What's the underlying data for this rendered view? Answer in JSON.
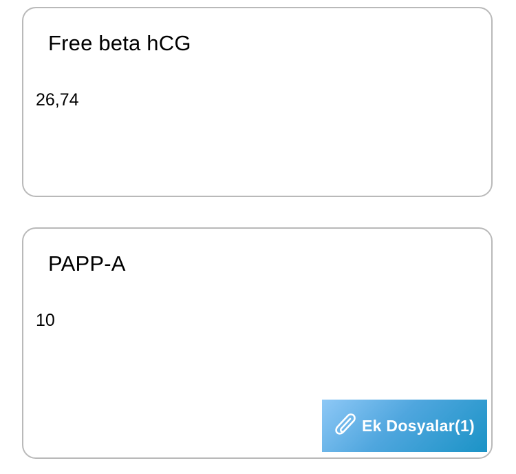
{
  "cards": [
    {
      "title": "Free beta hCG",
      "value": "26,74"
    },
    {
      "title": "PAPP-A",
      "value": "10"
    }
  ],
  "attachments": {
    "label": "Ek Dosyalar(1)",
    "icon": "paperclip-icon",
    "button_color_start": "#8ec8f6",
    "button_color_end": "#1b93c6"
  }
}
